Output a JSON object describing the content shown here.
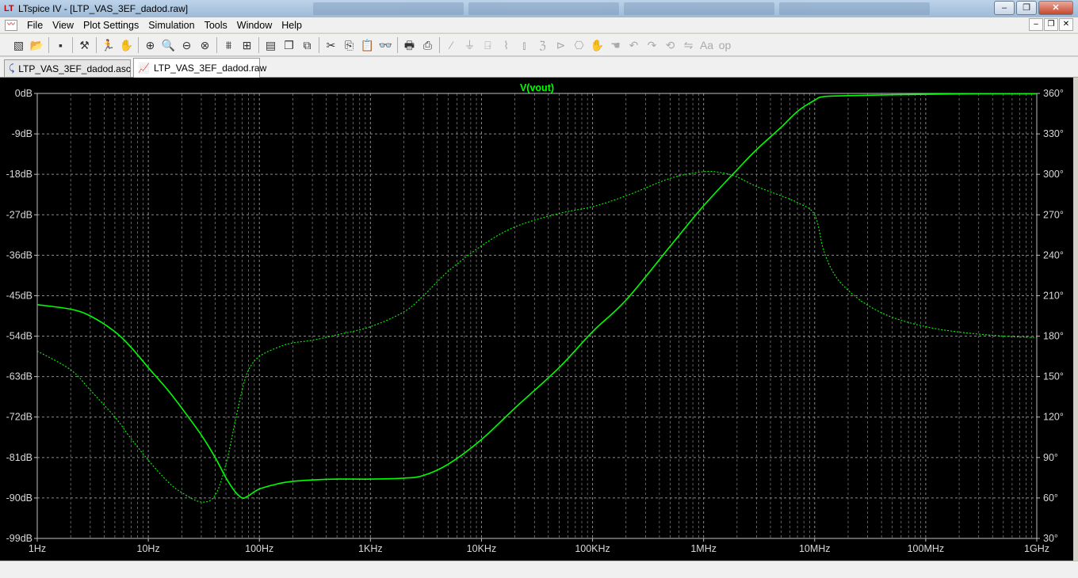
{
  "window": {
    "title": "LTspice IV - [LTP_VAS_3EF_dadod.raw]",
    "app_icon": "ltspice-icon",
    "buttons": [
      "–",
      "❐",
      "✕"
    ]
  },
  "menu": {
    "items": [
      "File",
      "View",
      "Plot Settings",
      "Simulation",
      "Tools",
      "Window",
      "Help"
    ],
    "mdi_buttons": [
      "–",
      "❐",
      "✕"
    ]
  },
  "toolbar": {
    "icons": [
      {
        "name": "new-schematic-icon",
        "glyph": "▧"
      },
      {
        "name": "open-icon",
        "glyph": "📂"
      },
      {
        "sep": true
      },
      {
        "name": "save-icon",
        "glyph": "▪"
      },
      {
        "sep": true
      },
      {
        "name": "control-panel-icon",
        "glyph": "⚒"
      },
      {
        "sep": true
      },
      {
        "name": "run-icon",
        "glyph": "🏃"
      },
      {
        "name": "halt-icon",
        "glyph": "✋",
        "dim": true
      },
      {
        "sep": true
      },
      {
        "name": "zoom-in-icon",
        "glyph": "⊕"
      },
      {
        "name": "zoom-area-icon",
        "glyph": "🔍"
      },
      {
        "name": "zoom-out-icon",
        "glyph": "⊖"
      },
      {
        "name": "zoom-fit-icon",
        "glyph": "⊗"
      },
      {
        "sep": true
      },
      {
        "name": "autorange-icon",
        "glyph": "⩩"
      },
      {
        "name": "pick-trace-icon",
        "glyph": "⊞"
      },
      {
        "sep": true
      },
      {
        "name": "tile-horizontal-icon",
        "glyph": "▤"
      },
      {
        "name": "cascade-icon",
        "glyph": "❐"
      },
      {
        "name": "close-all-icon",
        "glyph": "⧉"
      },
      {
        "sep": true
      },
      {
        "name": "cut-icon",
        "glyph": "✂"
      },
      {
        "name": "copy-icon",
        "glyph": "⎘"
      },
      {
        "name": "paste-icon",
        "glyph": "📋"
      },
      {
        "name": "find-icon",
        "glyph": "👓"
      },
      {
        "sep": true
      },
      {
        "name": "print-setup-icon",
        "glyph": "🖶"
      },
      {
        "name": "print-icon",
        "glyph": "⎙"
      },
      {
        "sep": true
      },
      {
        "name": "wire-icon",
        "glyph": "∕",
        "dim": true
      },
      {
        "name": "ground-icon",
        "glyph": "⏚",
        "dim": true
      },
      {
        "name": "label-icon",
        "glyph": "⍈",
        "dim": true
      },
      {
        "name": "resistor-icon",
        "glyph": "⌇",
        "dim": true
      },
      {
        "name": "capacitor-icon",
        "glyph": "⫾",
        "dim": true
      },
      {
        "name": "inductor-icon",
        "glyph": "ℨ",
        "dim": true
      },
      {
        "name": "diode-icon",
        "glyph": "⊳",
        "dim": true
      },
      {
        "name": "component-icon",
        "glyph": "⎔",
        "dim": true
      },
      {
        "name": "move-icon",
        "glyph": "✋",
        "dim": true
      },
      {
        "name": "drag-icon",
        "glyph": "☚",
        "dim": true
      },
      {
        "name": "undo-icon",
        "glyph": "↶",
        "dim": true
      },
      {
        "name": "redo-icon",
        "glyph": "↷",
        "dim": true
      },
      {
        "name": "rotate-icon",
        "glyph": "⟲",
        "dim": true
      },
      {
        "name": "mirror-icon",
        "glyph": "⇋",
        "dim": true
      },
      {
        "name": "text-icon",
        "glyph": "Aa",
        "dim": true
      },
      {
        "name": "spice-directive-icon",
        "glyph": "op",
        "dim": true
      }
    ]
  },
  "tabs": [
    {
      "label": "LTP_VAS_3EF_dadod.asc",
      "icon": "schematic-icon",
      "glyph": "⤹",
      "active": false
    },
    {
      "label": "LTP_VAS_3EF_dadod.raw",
      "icon": "waveform-icon",
      "glyph": "📈",
      "active": true
    }
  ],
  "colors": {
    "trace": "#00ff00",
    "background": "#000000",
    "grid": "#8a8a8a",
    "axis_text": "#d8d8d8"
  },
  "chart_data": {
    "type": "line",
    "title": "V(vout)",
    "x_scale": "log",
    "xlim": [
      1,
      1000000000
    ],
    "x_tick_labels": [
      "1Hz",
      "10Hz",
      "100Hz",
      "1KHz",
      "10KHz",
      "100KHz",
      "1MHz",
      "10MHz",
      "100MHz",
      "1GHz"
    ],
    "y_left_label_unit": "dB",
    "ylim_left": [
      -99,
      0
    ],
    "y_left_tick_labels": [
      "0dB",
      "-9dB",
      "-18dB",
      "-27dB",
      "-36dB",
      "-45dB",
      "-54dB",
      "-63dB",
      "-72dB",
      "-81dB",
      "-90dB",
      "-99dB"
    ],
    "ylim_right": [
      30,
      360
    ],
    "y_right_tick_labels": [
      "360°",
      "330°",
      "300°",
      "270°",
      "240°",
      "210°",
      "180°",
      "150°",
      "120°",
      "90°",
      "60°",
      "30°"
    ],
    "grid": true,
    "series": [
      {
        "name": "V(vout)",
        "style": "solid",
        "axis": "left",
        "x": [
          1,
          2,
          3,
          5,
          7,
          10,
          15,
          20,
          30,
          40,
          50,
          60,
          70,
          80,
          100,
          150,
          200,
          300,
          500,
          1000,
          2000,
          3000,
          5000,
          10000,
          20000,
          50000,
          100000,
          200000,
          500000,
          1000000,
          2000000,
          3000000,
          5000000,
          7000000,
          10000000,
          12000000,
          20000000,
          50000000,
          100000000,
          200000000,
          500000000,
          1000000000
        ],
        "y": [
          -47,
          -48,
          -49.5,
          -53,
          -56.5,
          -61,
          -66,
          -70,
          -76,
          -81,
          -85.5,
          -88.5,
          -90,
          -89.5,
          -88,
          -86.8,
          -86.3,
          -86,
          -85.8,
          -85.8,
          -85.6,
          -85,
          -82.5,
          -77,
          -70,
          -61,
          -53,
          -46,
          -34,
          -25,
          -17,
          -12.5,
          -7.5,
          -4,
          -1.5,
          -0.7,
          -0.5,
          -0.3,
          -0.2,
          -0.1,
          -0.05,
          -0.05
        ]
      },
      {
        "name": "V(vout) phase",
        "style": "dashed",
        "axis": "right",
        "x": [
          1,
          2,
          3,
          5,
          7,
          10,
          15,
          20,
          30,
          40,
          50,
          60,
          70,
          80,
          100,
          150,
          200,
          300,
          500,
          1000,
          2000,
          3000,
          5000,
          10000,
          20000,
          50000,
          100000,
          200000,
          500000,
          1000000,
          1500000,
          2000000,
          3000000,
          5000000,
          7000000,
          10000000,
          12000000,
          15000000,
          20000000,
          30000000,
          50000000,
          100000000,
          200000000,
          500000000,
          1000000000
        ],
        "y": [
          169,
          155,
          140,
          120,
          104,
          88,
          72,
          64,
          57,
          62,
          85,
          115,
          140,
          155,
          165,
          172,
          175,
          177,
          181,
          187,
          198,
          210,
          228,
          247,
          261,
          271,
          276,
          284,
          297,
          302,
          301,
          298,
          291,
          284,
          279,
          270,
          244,
          226,
          214,
          203,
          194,
          187,
          183,
          180,
          179
        ]
      }
    ]
  }
}
